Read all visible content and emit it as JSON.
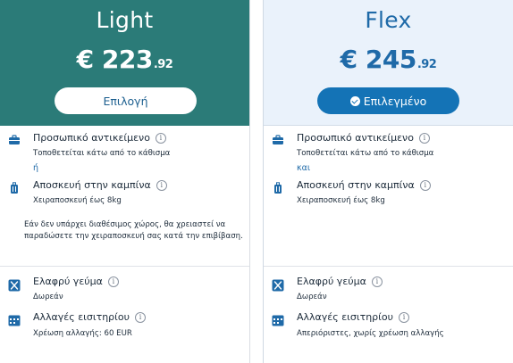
{
  "light": {
    "name": "Light",
    "price_main": "€ 223",
    "price_cents": ".92",
    "button_label": "Επιλογή",
    "personal_item_title": "Προσωπικό αντικείμενο",
    "personal_item_desc": "Τοποθετείται κάτω από το κάθισμα",
    "conjunction": "ή",
    "cabin_bag_title": "Αποσκευή στην καμπίνα",
    "cabin_bag_desc": "Χειραποσκευή έως 8kg",
    "note": "Εάν δεν υπάρχει διαθέσιμος χώρος, θα χρειαστεί να παραδώσετε την χειραποσκευή σας κατά την επιβίβαση.",
    "meal_title": "Ελαφρύ γεύμα",
    "meal_desc": "Δωρεάν",
    "changes_title": "Αλλαγές εισιτηρίου",
    "changes_desc": "Χρέωση αλλαγής: 60 EUR"
  },
  "flex": {
    "name": "Flex",
    "price_main": "€ 245",
    "price_cents": ".92",
    "button_label": "Επιλεγμένο",
    "personal_item_title": "Προσωπικό αντικείμενο",
    "personal_item_desc": "Τοποθετείται κάτω από το κάθισμα",
    "conjunction": "και",
    "cabin_bag_title": "Αποσκευή στην καμπίνα",
    "cabin_bag_desc": "Χειραποσκευή έως 8kg",
    "meal_title": "Ελαφρύ γεύμα",
    "meal_desc": "Δωρεάν",
    "changes_title": "Αλλαγές εισιτηρίου",
    "changes_desc": "Απεριόριστες, χωρίς χρέωση αλλαγής"
  },
  "info_glyph": "i",
  "colors": {
    "light_header": "#2b7b78",
    "flex_header": "#eaf2fb",
    "flex_text": "#1f6aa8",
    "selected_button": "#1473b6"
  },
  "icons": [
    "briefcase-icon",
    "suitcase-icon",
    "utensils-icon",
    "calendar-icon",
    "info-icon",
    "check-circle-icon"
  ]
}
